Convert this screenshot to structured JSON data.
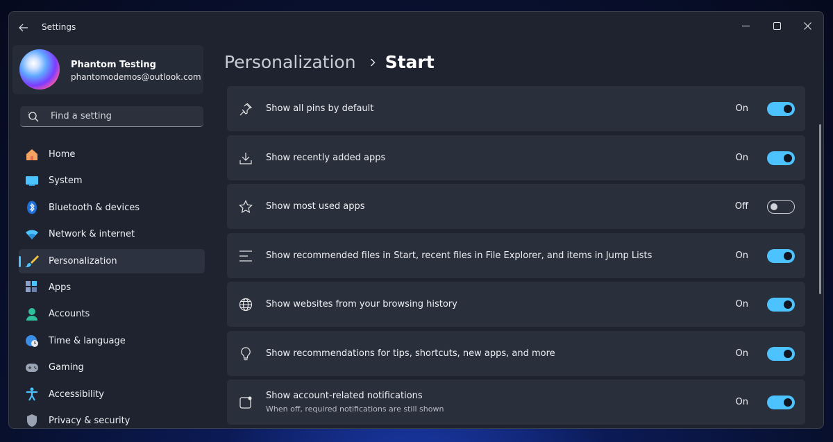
{
  "app": {
    "title": "Settings"
  },
  "profile": {
    "name": "Phantom Testing",
    "email": "phantomodemos@outlook.com"
  },
  "search": {
    "placeholder": "Find a setting"
  },
  "nav": {
    "items": [
      {
        "label": "Home",
        "icon": "home-icon",
        "active": false
      },
      {
        "label": "System",
        "icon": "system-icon",
        "active": false
      },
      {
        "label": "Bluetooth & devices",
        "icon": "bluetooth-icon",
        "active": false
      },
      {
        "label": "Network & internet",
        "icon": "wifi-icon",
        "active": false
      },
      {
        "label": "Personalization",
        "icon": "brush-icon",
        "active": true
      },
      {
        "label": "Apps",
        "icon": "apps-icon",
        "active": false
      },
      {
        "label": "Accounts",
        "icon": "accounts-icon",
        "active": false
      },
      {
        "label": "Time & language",
        "icon": "globe-clock-icon",
        "active": false
      },
      {
        "label": "Gaming",
        "icon": "gamepad-icon",
        "active": false
      },
      {
        "label": "Accessibility",
        "icon": "accessibility-icon",
        "active": false
      },
      {
        "label": "Privacy & security",
        "icon": "shield-icon",
        "active": false
      }
    ]
  },
  "breadcrumb": {
    "parent": "Personalization",
    "current": "Start"
  },
  "settings": [
    {
      "label": "Show all pins by default",
      "description": "",
      "icon": "pin-icon",
      "state": "On",
      "on": true
    },
    {
      "label": "Show recently added apps",
      "description": "",
      "icon": "download-icon",
      "state": "On",
      "on": true
    },
    {
      "label": "Show most used apps",
      "description": "",
      "icon": "star-icon",
      "state": "Off",
      "on": false
    },
    {
      "label": "Show recommended files in Start, recent files in File Explorer, and items in Jump Lists",
      "description": "",
      "icon": "list-icon",
      "state": "On",
      "on": true
    },
    {
      "label": "Show websites from your browsing history",
      "description": "",
      "icon": "globe-icon",
      "state": "On",
      "on": true
    },
    {
      "label": "Show recommendations for tips, shortcuts, new apps, and more",
      "description": "",
      "icon": "lightbulb-icon",
      "state": "On",
      "on": true
    },
    {
      "label": "Show account-related notifications",
      "description": "When off, required notifications are still shown",
      "icon": "notification-icon",
      "state": "On",
      "on": true
    }
  ],
  "colors": {
    "accent": "#4cc2ff",
    "window_bg": "#1f2330",
    "card_bg": "#2a2f3c"
  }
}
